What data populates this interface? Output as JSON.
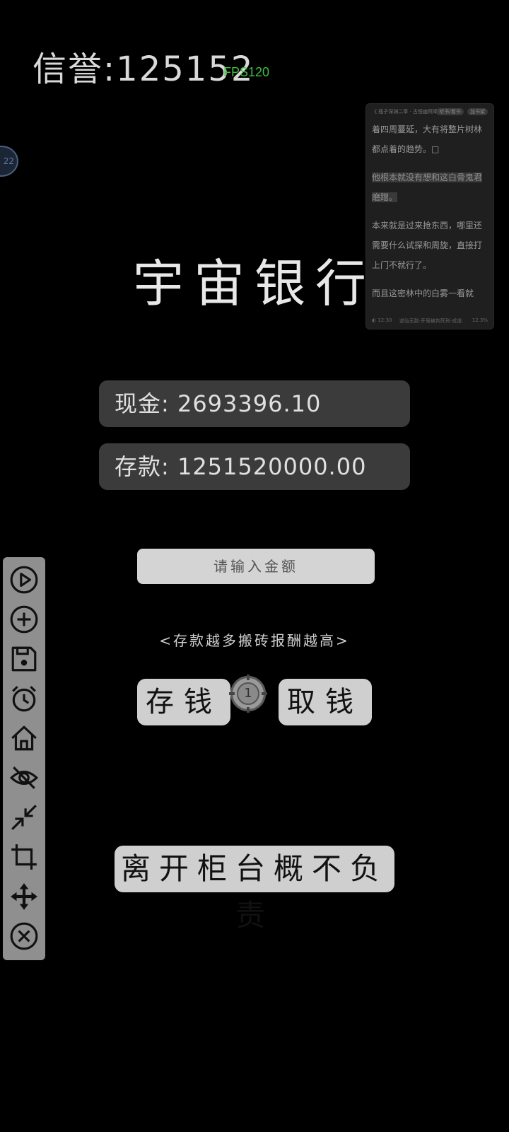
{
  "header": {
    "credit_text": "信誉:125152",
    "fps_text": "FPS120"
  },
  "edge_badge": {
    "text": "22"
  },
  "reader": {
    "top_left": "《 瓶子深渊二章  ·  古怪幽冥降临...",
    "badges": [
      "听书/看书",
      "加书架"
    ],
    "paragraphs": [
      {
        "text": "着四周蔓延，大有将整片树林都点着的趋势。□",
        "highlight": false
      },
      {
        "text": "他根本就没有想和这白骨鬼君磨蹭。",
        "highlight": true
      },
      {
        "text": "本来就是过来抢东西，哪里还需要什么试探和周旋，直接打上门不就行了。",
        "highlight": false
      },
      {
        "text": "而且这密林中的白雾一看就",
        "highlight": false
      }
    ],
    "bottom_left": "◐ 12:30",
    "bottom_mid": "逆仙无敌·开局被判死刑·成道..",
    "bottom_right": "12.3%"
  },
  "bank": {
    "title": "宇宙银行",
    "cash_text": "现金: 2693396.10",
    "deposit_text": "存款: 1251520000.00",
    "amount_placeholder": "请输入金额",
    "hint": "<存款越多搬砖报酬越高>",
    "save_label": "存钱",
    "withdraw_label": "取钱",
    "knob_number": "1",
    "leave_label": "离开柜台概不负责"
  },
  "tools": [
    {
      "icon": "play-circle-icon"
    },
    {
      "icon": "plus-circle-icon"
    },
    {
      "icon": "save-icon"
    },
    {
      "icon": "alarm-clock-icon"
    },
    {
      "icon": "home-icon"
    },
    {
      "icon": "eye-off-icon"
    },
    {
      "icon": "minimize-arrows-icon"
    },
    {
      "icon": "crop-icon"
    },
    {
      "icon": "move-icon"
    },
    {
      "icon": "close-circle-icon"
    }
  ]
}
